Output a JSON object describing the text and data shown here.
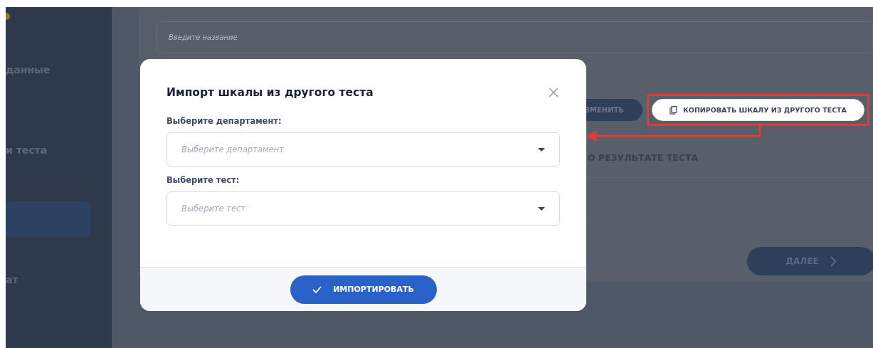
{
  "sidebar": {
    "items": [
      {
        "label": "данные",
        "selected": false
      },
      {
        "label": "и теста",
        "selected": false
      },
      {
        "selected": true
      },
      {
        "label": "ат",
        "selected": false
      }
    ]
  },
  "main": {
    "name_field": {
      "placeholder": "Введите название"
    },
    "buttons": [
      {
        "kind": "dark",
        "label": "ЗМЕНИТЬ",
        "highlighted": false
      },
      {
        "kind": "outline",
        "label": "КОПИРОВАТЬ ШКАЛУ ИЗ ДРУГОГО ТЕСТА",
        "highlighted": true
      }
    ],
    "section_title": "О РЕЗУЛЬТАТЕ ТЕСТА",
    "next_button": "ДАЛЕЕ"
  },
  "dialog": {
    "title": "Импорт шкалы из другого теста",
    "fields": [
      {
        "label": "Выберите департамент:",
        "placeholder": "Выберите департамент"
      },
      {
        "label": "Выберите тест:",
        "placeholder": "Выберите тест"
      }
    ],
    "submit": "ИМПОРТИРОВАТЬ"
  }
}
